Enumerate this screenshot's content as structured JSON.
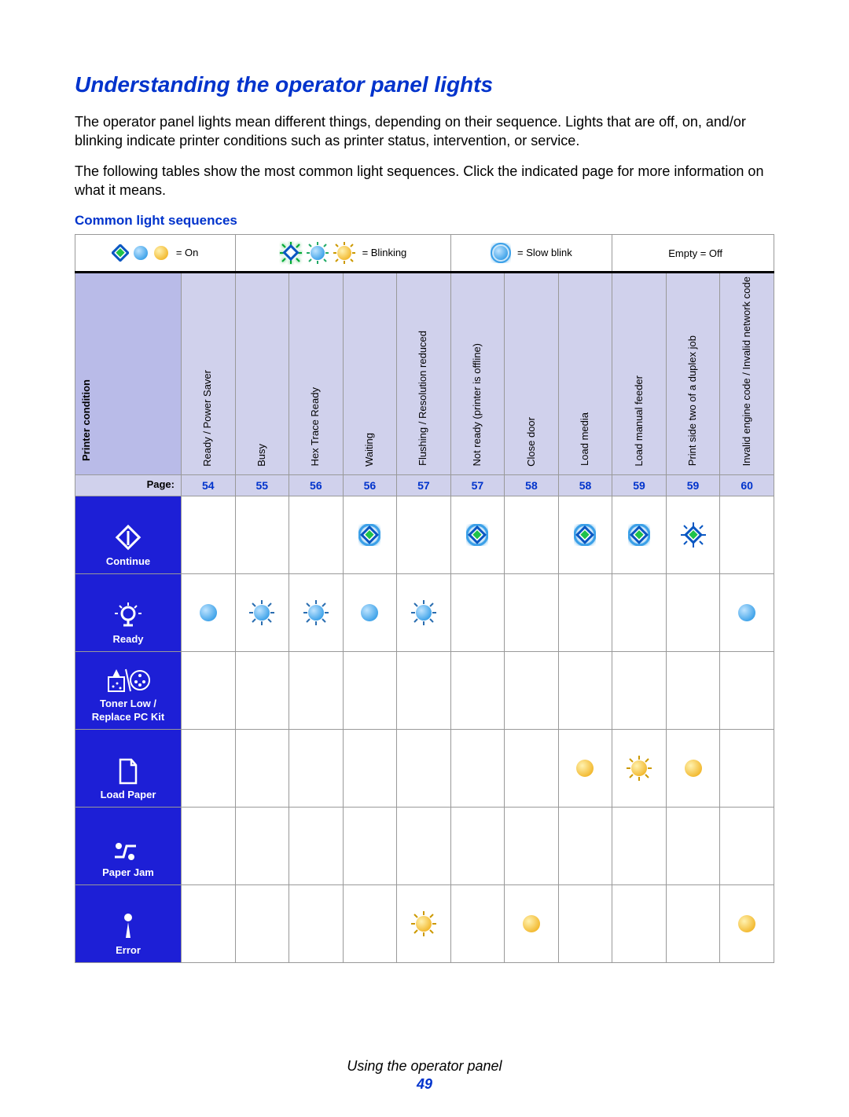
{
  "title": "Understanding the operator panel lights",
  "para1": "The operator panel lights mean different things, depending on their sequence. Lights that are off, on, and/or blinking indicate printer conditions such as printer status, intervention, or service.",
  "para2": "The following tables show the most common light sequences. Click the indicated page for more information on what it means.",
  "table_title": "Common light sequences",
  "legend": {
    "on": "= On",
    "blinking": "= Blinking",
    "slow": "= Slow blink",
    "off": "Empty = Off"
  },
  "hdr_first": "Printer condition",
  "columns": [
    "Ready / Power Saver",
    "Busy",
    "Hex Trace Ready",
    "Waiting",
    "Flushing / Resolution reduced",
    "Not ready (printer is offline)",
    "Close door",
    "Load media",
    "Load manual feeder",
    "Print side two of a duplex job",
    "Invalid engine code / Invalid network code"
  ],
  "page_label": "Page:",
  "pages": [
    "54",
    "55",
    "56",
    "56",
    "57",
    "57",
    "58",
    "58",
    "59",
    "59",
    "60"
  ],
  "rows": [
    {
      "label": "Continue",
      "icon": "continue"
    },
    {
      "label": "Ready",
      "icon": "ready"
    },
    {
      "label": "Toner Low / Replace PC Kit",
      "icon": "toner"
    },
    {
      "label": "Load Paper",
      "icon": "loadpaper"
    },
    {
      "label": "Paper Jam",
      "icon": "paperjam"
    },
    {
      "label": "Error",
      "icon": "error"
    }
  ],
  "cells": {
    "Continue": [
      "",
      "",
      "",
      "on-g",
      "",
      "on-g",
      "",
      "on-g",
      "on-g",
      "blink-g",
      ""
    ],
    "Ready": [
      "on-b",
      "blink-b",
      "blink-b",
      "on-b",
      "blink-b",
      "",
      "",
      "",
      "",
      "",
      "on-b"
    ],
    "Toner Low / Replace PC Kit": [
      "",
      "",
      "",
      "",
      "",
      "",
      "",
      "",
      "",
      "",
      ""
    ],
    "Load Paper": [
      "",
      "",
      "",
      "",
      "",
      "",
      "",
      "on-y",
      "blink-y",
      "on-y",
      ""
    ],
    "Paper Jam": [
      "",
      "",
      "",
      "",
      "",
      "",
      "",
      "",
      "",
      "",
      ""
    ],
    "Error": [
      "",
      "",
      "",
      "",
      "blink-y",
      "",
      "on-y",
      "",
      "",
      "",
      "on-y"
    ]
  },
  "footer_text": "Using the operator panel",
  "footer_page": "49"
}
